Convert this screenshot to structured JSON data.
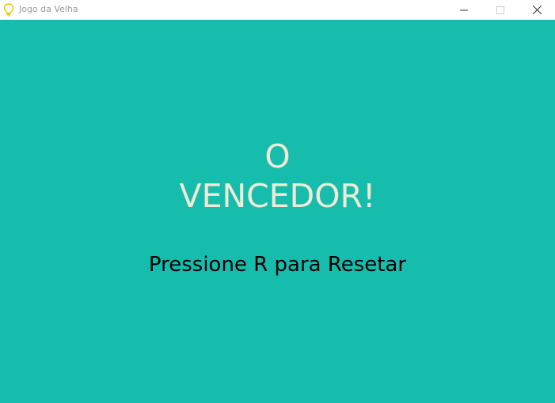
{
  "window": {
    "title": "Jogo da Velha",
    "icon": "lightbulb-icon",
    "controls": {
      "minimize": "minimize-icon",
      "maximize": "maximize-icon",
      "close": "close-icon"
    }
  },
  "game": {
    "background_color": "#16bdad",
    "winner_line1": "O",
    "winner_line2": "VENCEDOR!",
    "winner_color": "#f0ead6",
    "reset_hint": "Pressione R para Resetar",
    "reset_hint_color": "#000000"
  }
}
